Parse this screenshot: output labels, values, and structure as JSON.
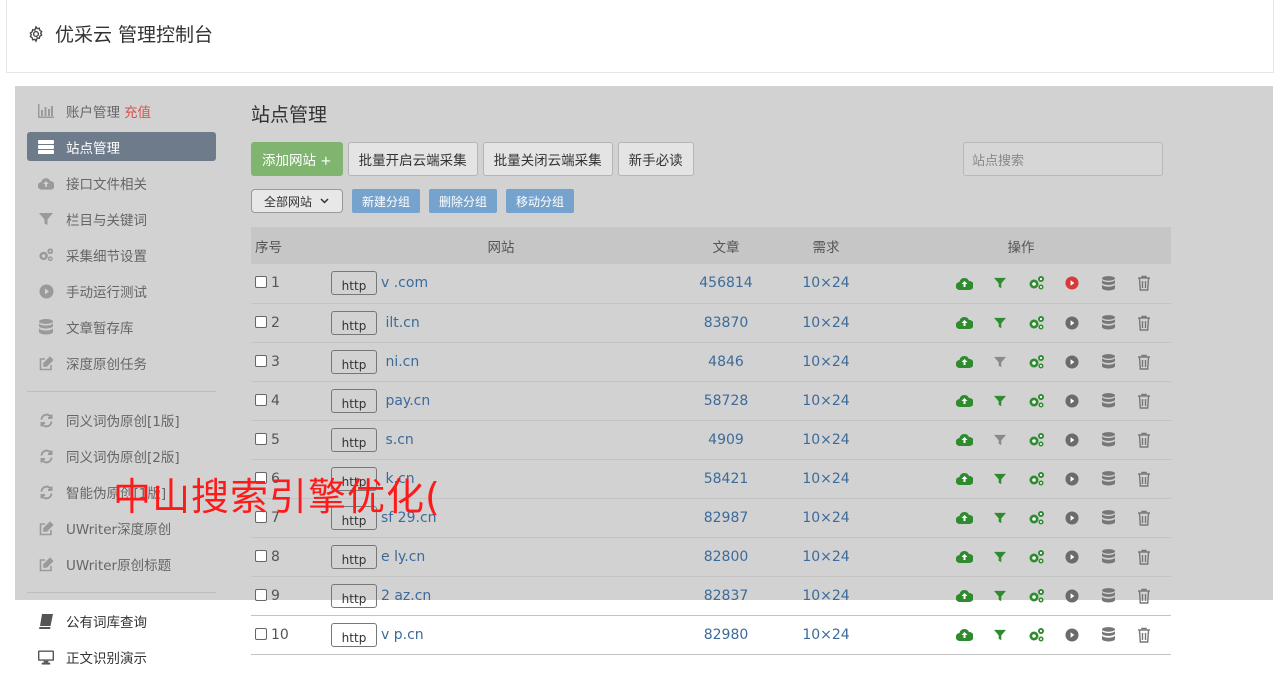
{
  "app": {
    "title": "优采云 管理控制台"
  },
  "sidebar": {
    "items": [
      {
        "label": "账户管理",
        "extra": "充值",
        "icon": "bar-chart-icon"
      },
      {
        "label": "站点管理",
        "icon": "server-icon",
        "active": true
      },
      {
        "label": "接口文件相关",
        "icon": "cloud-upload-icon"
      },
      {
        "label": "栏目与关键词",
        "icon": "filter-icon"
      },
      {
        "label": "采集细节设置",
        "icon": "gears-icon"
      },
      {
        "label": "手动运行测试",
        "icon": "play-circle-icon"
      },
      {
        "label": "文章暂存库",
        "icon": "database-icon"
      },
      {
        "label": "深度原创任务",
        "icon": "edit-icon"
      }
    ],
    "items2": [
      {
        "label": "同义词伪原创[1版]",
        "icon": "refresh-icon"
      },
      {
        "label": "同义词伪原创[2版]",
        "icon": "refresh-icon"
      },
      {
        "label": "智能伪原创[1版]",
        "icon": "refresh-icon"
      },
      {
        "label": "UWriter深度原创",
        "icon": "edit-icon"
      },
      {
        "label": "UWriter原创标题",
        "icon": "edit-icon"
      }
    ],
    "items3": [
      {
        "label": "公有词库查询",
        "icon": "book-icon"
      },
      {
        "label": "正文识别演示",
        "icon": "monitor-icon"
      }
    ]
  },
  "main": {
    "title": "站点管理",
    "buttons": {
      "add": "添加网站 +",
      "batch_open": "批量开启云端采集",
      "batch_close": "批量关闭云端采集",
      "guide": "新手必读"
    },
    "search_placeholder": "站点搜索",
    "group_select": "全部网站",
    "group_buttons": {
      "new": "新建分组",
      "delete": "删除分组",
      "move": "移动分组"
    },
    "columns": {
      "no": "序号",
      "site": "网站",
      "articles": "文章",
      "demand": "需求",
      "ops": "操作"
    },
    "http_label": "http",
    "rows": [
      {
        "no": "1",
        "domain": "v             .com",
        "articles": "456814",
        "demand": "10×24",
        "running": true
      },
      {
        "no": "2",
        "domain": "    ilt.cn",
        "articles": "83870",
        "demand": "10×24"
      },
      {
        "no": "3",
        "domain": "     ni.cn",
        "articles": "4846",
        "demand": "10×24"
      },
      {
        "no": "4",
        "domain": "       pay.cn",
        "articles": "58728",
        "demand": "10×24"
      },
      {
        "no": "5",
        "domain": "       s.cn",
        "articles": "4909",
        "demand": "10×24"
      },
      {
        "no": "6",
        "domain": "       k.cn",
        "articles": "58421",
        "demand": "10×24"
      },
      {
        "no": "7",
        "domain": "sf  29.cn",
        "articles": "82987",
        "demand": "10×24"
      },
      {
        "no": "8",
        "domain": "e      ly.cn",
        "articles": "82800",
        "demand": "10×24"
      },
      {
        "no": "9",
        "domain": "2     az.cn",
        "articles": "82837",
        "demand": "10×24"
      },
      {
        "no": "10",
        "domain": "v    p.cn",
        "articles": "82980",
        "demand": "10×24"
      }
    ]
  },
  "watermark": "中山搜索引擎优化(",
  "colors": {
    "green": "#2e8b2e",
    "red": "#d9383a",
    "link": "#3c6b9b",
    "active_nav": "#6e7b8b"
  }
}
